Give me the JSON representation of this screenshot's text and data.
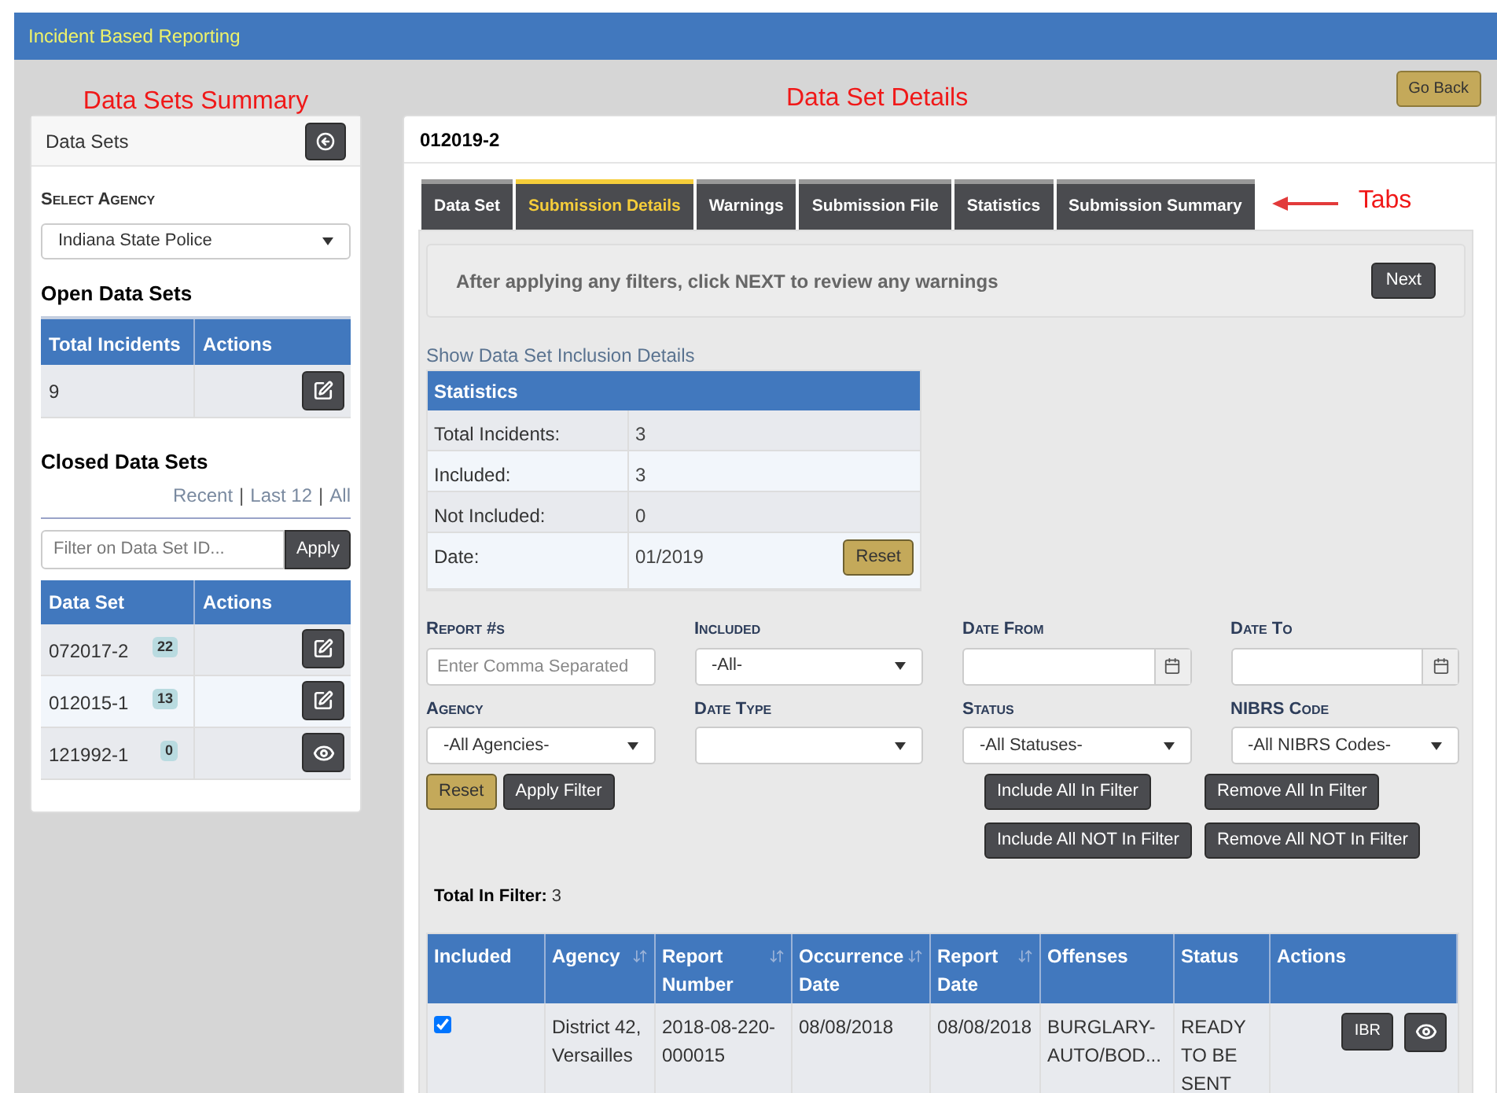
{
  "app_title": "Incident Based Reporting",
  "annotations": {
    "summary": "Data Sets Summary",
    "details": "Data Set Details",
    "tabs": "Tabs"
  },
  "go_back": "Go Back",
  "sidebar": {
    "title": "Data Sets",
    "agency_label": "Select Agency",
    "agency_value": "Indiana State Police",
    "open_title": "Open Data Sets",
    "open_columns": [
      "Total Incidents",
      "Actions"
    ],
    "open_rows": [
      {
        "value": "9",
        "kind": "edit"
      }
    ],
    "closed_title": "Closed Data Sets",
    "closed_links": [
      {
        "label": "Recent"
      },
      {
        "label": "Last 12"
      },
      {
        "label": "All"
      }
    ],
    "link_separator": "|",
    "filter_placeholder": "Filter on Data Set ID...",
    "apply": "Apply",
    "closed_columns": [
      "Data Set",
      "Actions"
    ],
    "closed_rows": [
      {
        "name": "072017-2",
        "count": "22",
        "kind": "edit"
      },
      {
        "name": "012015-1",
        "count": "13",
        "kind": "edit"
      },
      {
        "name": "121992-1",
        "count": "0",
        "kind": "view"
      }
    ]
  },
  "details": {
    "title": "012019-2",
    "tabs": [
      {
        "label": "Data Set",
        "selected": false
      },
      {
        "label": "Submission Details",
        "selected": true
      },
      {
        "label": "Warnings",
        "selected": false
      },
      {
        "label": "Submission File",
        "selected": false
      },
      {
        "label": "Statistics",
        "selected": false
      },
      {
        "label": "Submission Summary",
        "selected": false
      }
    ],
    "notice": "After applying any filters, click NEXT to review any warnings",
    "next": "Next",
    "inclusion_link": "Show Data Set Inclusion Details",
    "statistics": {
      "title": "Statistics",
      "rows": [
        {
          "label": "Total Incidents:",
          "value": "3"
        },
        {
          "label": "Included:",
          "value": "3"
        },
        {
          "label": "Not Included:",
          "value": "0"
        },
        {
          "label": "Date:",
          "value": "01/2019"
        }
      ],
      "reset": "Reset"
    },
    "filters": [
      {
        "label": "Report #s",
        "kind": "text",
        "placeholder": "Enter Comma Separated"
      },
      {
        "label": "Included",
        "kind": "select",
        "value": "-All-"
      },
      {
        "label": "Date From",
        "kind": "date"
      },
      {
        "label": "Date To",
        "kind": "date"
      },
      {
        "label": "Agency",
        "kind": "select",
        "value": "-All Agencies-"
      },
      {
        "label": "Date Type",
        "kind": "select"
      },
      {
        "label": "Status",
        "kind": "select",
        "value": "-All Statuses-"
      },
      {
        "label": "NIBRS Code",
        "kind": "select",
        "value": "-All NIBRS Codes-"
      }
    ],
    "reset": "Reset",
    "apply_filter": "Apply Filter",
    "bulk_buttons": [
      "Include All In Filter",
      "Remove All In Filter",
      "Include All NOT In Filter",
      "Remove All NOT In Filter"
    ],
    "total_label": "Total In Filter:",
    "total_value": "3",
    "table": {
      "columns": [
        {
          "label": "Included",
          "sortable": false
        },
        {
          "label": "Agency",
          "sortable": true
        },
        {
          "label": "Report Number",
          "sortable": true
        },
        {
          "label": "Occurrence Date",
          "sortable": true
        },
        {
          "label": "Report Date",
          "sortable": true
        },
        {
          "label": "Offenses",
          "sortable": false
        },
        {
          "label": "Status",
          "sortable": false
        },
        {
          "label": "Actions",
          "sortable": false
        }
      ],
      "rows": [
        {
          "included": true,
          "agency": "District 42, Versailles",
          "report_number": "2018-08-220-000015",
          "occurrence_date": "08/08/2018",
          "report_date": "08/08/2018",
          "offenses": "BURGLARY-AUTO/BOD...",
          "status": "READY TO BE SENT",
          "ibr": "IBR"
        }
      ]
    }
  }
}
